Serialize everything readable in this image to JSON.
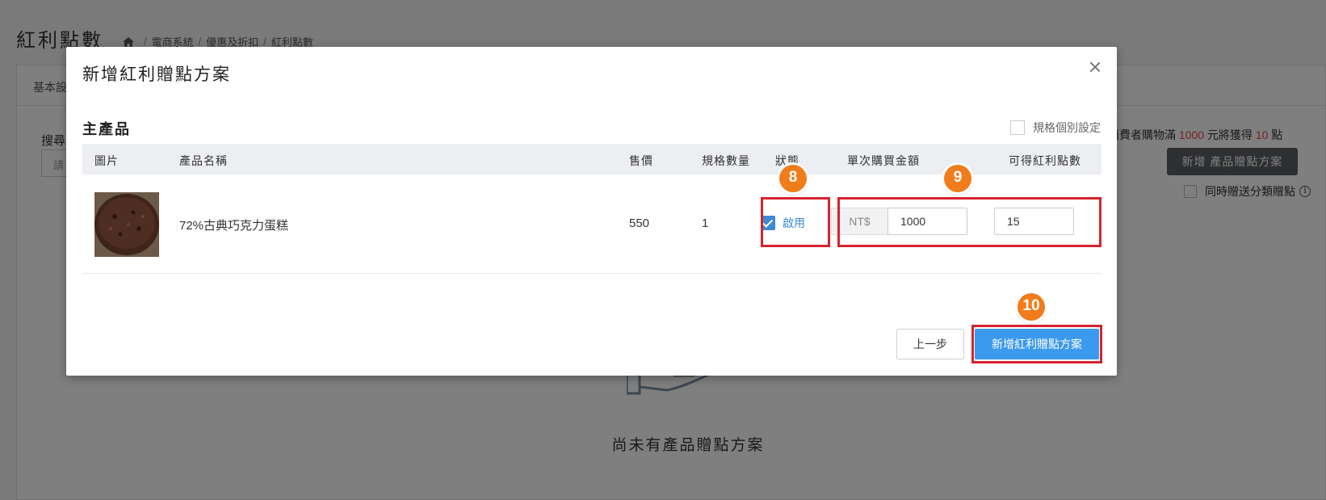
{
  "background": {
    "page_title": "紅利點數",
    "breadcrumb": [
      "電商系統",
      "優惠及折扣",
      "紅利點數"
    ],
    "tab_label": "基本設",
    "search_label": "搜尋",
    "search_placeholder": "請",
    "rule_text_prefix": "消費者購物滿",
    "rule_amount": "1000",
    "rule_text_mid": "元將獲得",
    "rule_points": "10",
    "rule_text_suffix": "點",
    "add_product_button": "新增 產品贈點方案",
    "also_category_label": "同時贈送分類贈點",
    "empty_text": "尚未有產品贈點方案"
  },
  "modal": {
    "title": "新增紅利贈點方案",
    "section_title": "主產品",
    "spec_individual_label": "規格個別設定",
    "columns": [
      "圖片",
      "產品名稱",
      "售價",
      "規格數量",
      "狀態",
      "單次購買金額",
      "可得紅利點數"
    ],
    "row": {
      "product_name": "72%古典巧克力蛋糕",
      "price": "550",
      "spec_count": "1",
      "status_label": "啟用",
      "currency": "NT$",
      "purchase_amount": "1000",
      "bonus_points": "15"
    },
    "prev_button": "上一步",
    "submit_button": "新增紅利贈點方案"
  },
  "annotations": {
    "badge_status": "8",
    "badge_amount": "9",
    "badge_submit": "10",
    "highlight_color": "#d6232f",
    "badge_color": "#f07c1b"
  },
  "colors": {
    "primary": "#3c9aee",
    "link_blue": "#3b8ad6",
    "accent_red": "#e64545"
  }
}
